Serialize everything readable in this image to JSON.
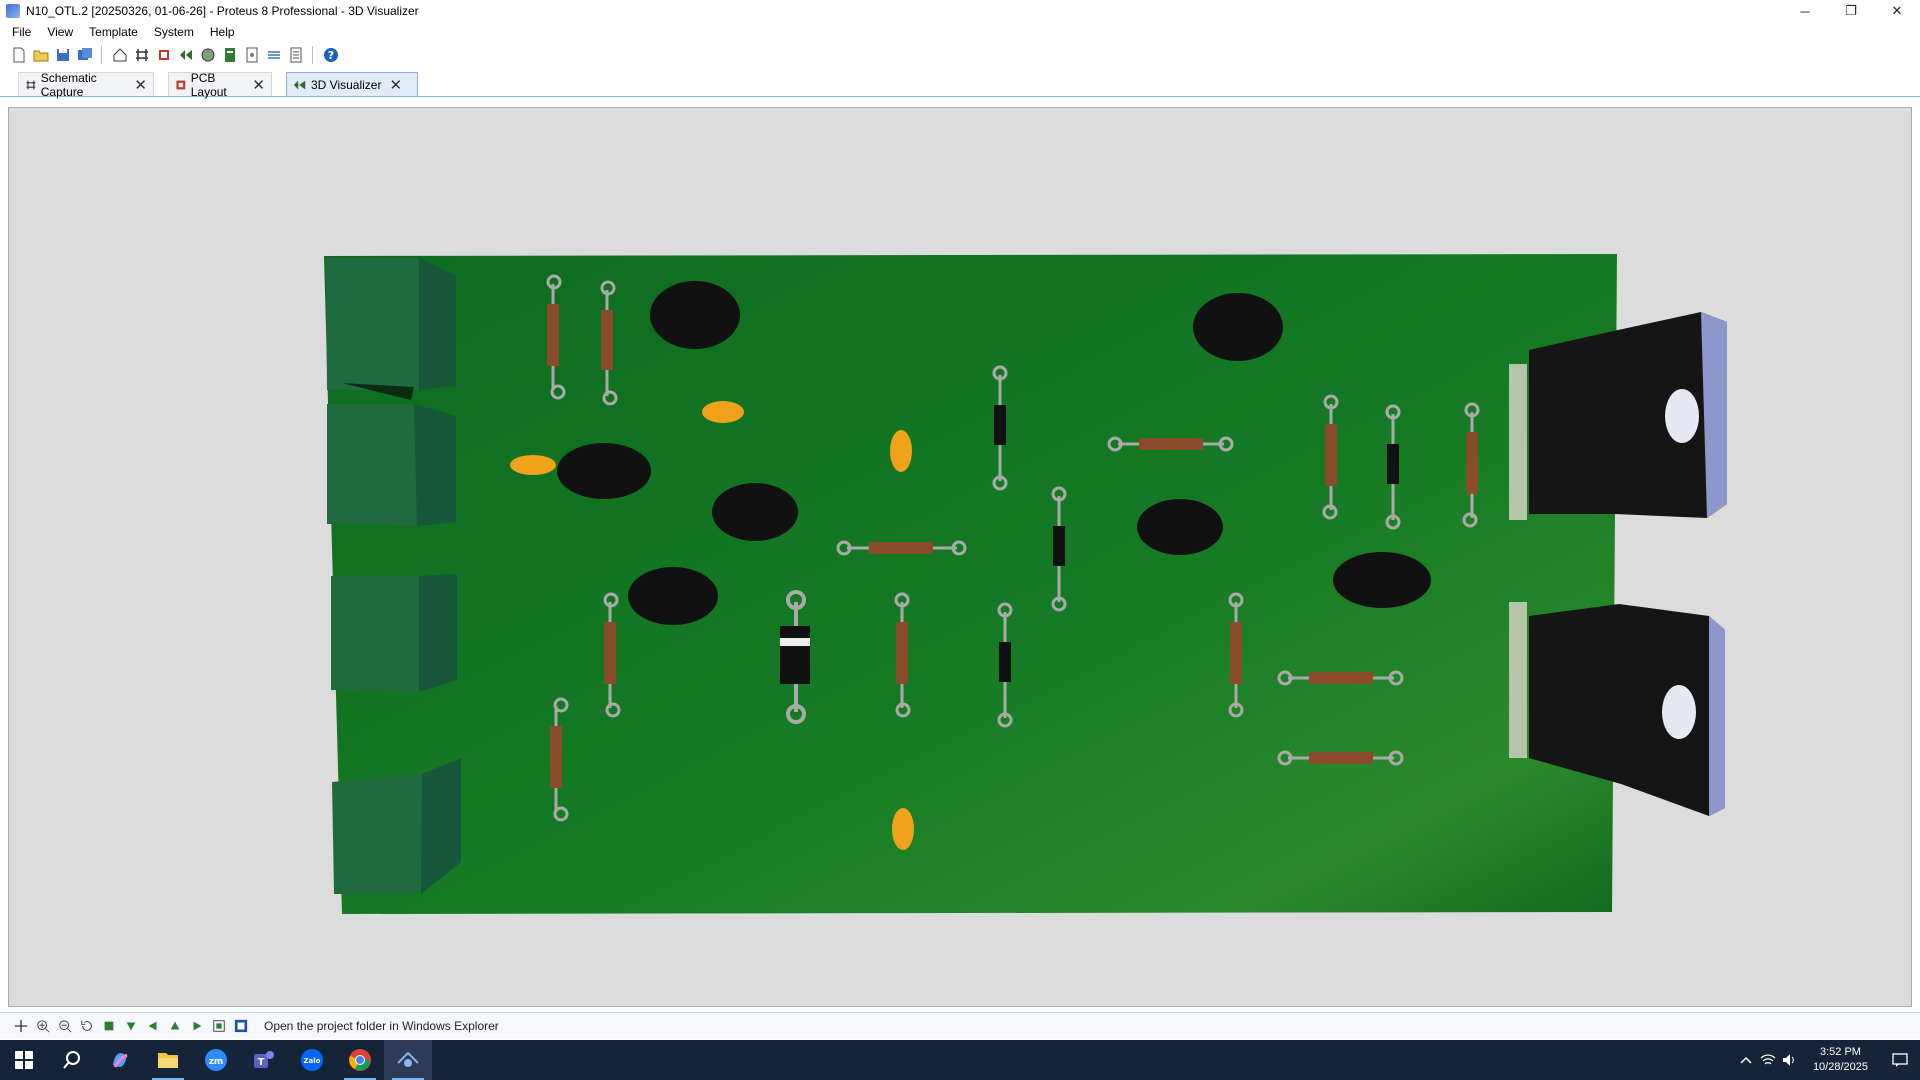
{
  "window": {
    "title": "N10_OTL.2 [20250326, 01-06-26] - Proteus 8 Professional - 3D Visualizer",
    "minimize": "─",
    "restore": "❐",
    "close": "✕"
  },
  "menu": [
    "File",
    "View",
    "Template",
    "System",
    "Help"
  ],
  "toolbar_icons": [
    "new-file-icon",
    "open-folder-icon",
    "save-icon",
    "save-all-icon",
    "home-icon",
    "schematic-icon",
    "pcb-icon",
    "3d-icon",
    "gerber-icon",
    "bom-icon",
    "design-explorer-icon",
    "notes-icon",
    "report-icon",
    "help-icon"
  ],
  "tabs": [
    {
      "label": "Schematic Capture",
      "icon": "schematic-icon",
      "active": false
    },
    {
      "label": "PCB Layout",
      "icon": "pcb-icon",
      "active": false
    },
    {
      "label": "3D Visualizer",
      "icon": "3d-icon",
      "active": true
    }
  ],
  "tab_close": "✕",
  "status": {
    "text": "Open the project folder in Windows Explorer",
    "nav_icons": [
      "pan-icon",
      "zoom-in-icon",
      "zoom-out-icon",
      "rotate-icon",
      "top-view-icon",
      "front-view-icon",
      "left-view-icon",
      "back-view-icon",
      "right-view-icon",
      "fit-icon",
      "board-view-icon"
    ]
  },
  "taskbar": {
    "apps": [
      "windows-start-icon",
      "search-icon",
      "copilot-icon",
      "file-explorer-icon",
      "zoom-icon",
      "teams-icon",
      "zalo-icon",
      "chrome-icon",
      "proteus-icon"
    ],
    "time": "3:52 PM",
    "date": "10/28/2025"
  },
  "colors": {
    "board": "#1a7a2a",
    "connector": "#1f6b3d",
    "viewport_bg": "#dcdcdc",
    "taskbar": "#16243a"
  }
}
